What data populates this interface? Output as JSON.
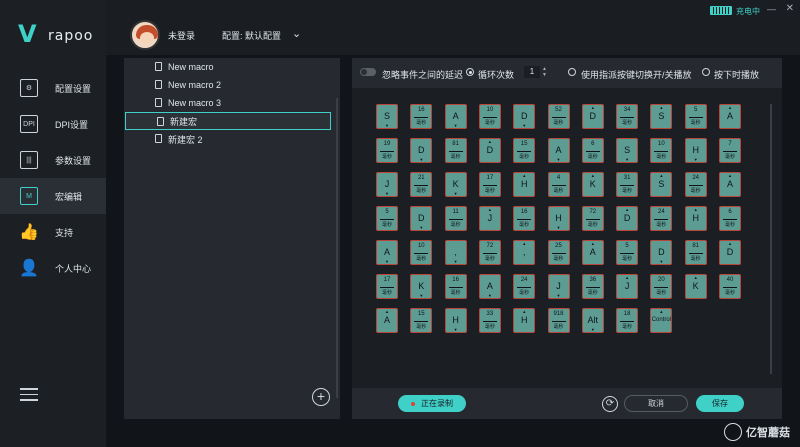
{
  "brand": {
    "logo_mark": "V",
    "logo_text": "rapoo"
  },
  "window": {
    "battery_icon": "battery-icon",
    "charging": "充电中",
    "min": "—",
    "close": "✕"
  },
  "header": {
    "login": "未登录",
    "config": "配置: 默认配置",
    "chevron": "⌄"
  },
  "sidebar": {
    "items": [
      {
        "label": "配置设置",
        "icon": "⚙",
        "active": false
      },
      {
        "label": "DPI设置",
        "icon": "DPI",
        "active": false
      },
      {
        "label": "参数设置",
        "icon": "|||",
        "active": false
      },
      {
        "label": "宏编辑",
        "icon": "M",
        "active": true
      },
      {
        "label": "支持",
        "icon": "👍",
        "active": false
      },
      {
        "label": "个人中心",
        "icon": "👤",
        "active": false
      }
    ]
  },
  "macros": {
    "items": [
      "New macro",
      "New macro 2",
      "New macro 3",
      "新建宏",
      "新建宏 2"
    ],
    "selected_index": 3,
    "add_label": "+"
  },
  "toolbar": {
    "ignore_delay": "忽略事件之间的延迟",
    "loop_count_label": "循环次数",
    "loop_count": "1",
    "toggle_mode": "使用指派按键切换开/关播放",
    "hold_mode": "按下时播放"
  },
  "delay_unit": "毫秒",
  "events": [
    [
      {
        "t": "k",
        "v": "S",
        "d": "down"
      },
      {
        "t": "d",
        "v": "16"
      },
      {
        "t": "k",
        "v": "A",
        "d": "down"
      },
      {
        "t": "d",
        "v": "10"
      },
      {
        "t": "k",
        "v": "D",
        "d": "down"
      },
      {
        "t": "d",
        "v": "52"
      },
      {
        "t": "k",
        "v": "D",
        "d": "up"
      },
      {
        "t": "d",
        "v": "34"
      },
      {
        "t": "k",
        "v": "S",
        "d": "up"
      },
      {
        "t": "d",
        "v": "5"
      },
      {
        "t": "k",
        "v": "A",
        "d": "up"
      }
    ],
    [
      {
        "t": "d",
        "v": "19"
      },
      {
        "t": "k",
        "v": "D",
        "d": "down"
      },
      {
        "t": "d",
        "v": "81"
      },
      {
        "t": "k",
        "v": "D",
        "d": "up"
      },
      {
        "t": "d",
        "v": "15"
      },
      {
        "t": "k",
        "v": "A",
        "d": "down"
      },
      {
        "t": "d",
        "v": "6"
      },
      {
        "t": "k",
        "v": "S",
        "d": "down"
      },
      {
        "t": "d",
        "v": "10"
      },
      {
        "t": "k",
        "v": "H",
        "d": "down"
      },
      {
        "t": "d",
        "v": "7"
      }
    ],
    [
      {
        "t": "k",
        "v": "J",
        "d": "down"
      },
      {
        "t": "d",
        "v": "21"
      },
      {
        "t": "k",
        "v": "K",
        "d": "down"
      },
      {
        "t": "d",
        "v": "17"
      },
      {
        "t": "k",
        "v": "H",
        "d": "up"
      },
      {
        "t": "d",
        "v": "4"
      },
      {
        "t": "k",
        "v": "K",
        "d": "up"
      },
      {
        "t": "d",
        "v": "31"
      },
      {
        "t": "k",
        "v": "S",
        "d": "up"
      },
      {
        "t": "d",
        "v": "24"
      },
      {
        "t": "k",
        "v": "A",
        "d": "up"
      }
    ],
    [
      {
        "t": "d",
        "v": "5"
      },
      {
        "t": "k",
        "v": "D",
        "d": "down"
      },
      {
        "t": "d",
        "v": "11"
      },
      {
        "t": "k",
        "v": "J",
        "d": "up"
      },
      {
        "t": "d",
        "v": "16"
      },
      {
        "t": "k",
        "v": "H",
        "d": "down"
      },
      {
        "t": "d",
        "v": "72"
      },
      {
        "t": "k",
        "v": "D",
        "d": "up"
      },
      {
        "t": "d",
        "v": "24"
      },
      {
        "t": "k",
        "v": "H",
        "d": "up"
      },
      {
        "t": "d",
        "v": "6"
      }
    ],
    [
      {
        "t": "k",
        "v": "A",
        "d": "down"
      },
      {
        "t": "d",
        "v": "10"
      },
      {
        "t": "k",
        "v": ",",
        "d": "down"
      },
      {
        "t": "d",
        "v": "72"
      },
      {
        "t": "k",
        "v": ",",
        "d": "up"
      },
      {
        "t": "d",
        "v": "25"
      },
      {
        "t": "k",
        "v": "A",
        "d": "up"
      },
      {
        "t": "d",
        "v": "5"
      },
      {
        "t": "k",
        "v": "D",
        "d": "down"
      },
      {
        "t": "d",
        "v": "81"
      },
      {
        "t": "k",
        "v": "D",
        "d": "up"
      }
    ],
    [
      {
        "t": "d",
        "v": "17"
      },
      {
        "t": "k",
        "v": "K",
        "d": "down"
      },
      {
        "t": "d",
        "v": "16"
      },
      {
        "t": "k",
        "v": "A",
        "d": "down"
      },
      {
        "t": "d",
        "v": "24"
      },
      {
        "t": "k",
        "v": "J",
        "d": "down"
      },
      {
        "t": "d",
        "v": "36"
      },
      {
        "t": "k",
        "v": "J",
        "d": "up"
      },
      {
        "t": "d",
        "v": "20"
      },
      {
        "t": "k",
        "v": "K",
        "d": "up"
      },
      {
        "t": "d",
        "v": "40"
      }
    ],
    [
      {
        "t": "k",
        "v": "A",
        "d": "up"
      },
      {
        "t": "d",
        "v": "15"
      },
      {
        "t": "k",
        "v": "H",
        "d": "down"
      },
      {
        "t": "d",
        "v": "33"
      },
      {
        "t": "k",
        "v": "H",
        "d": "up"
      },
      {
        "t": "d",
        "v": "918"
      },
      {
        "t": "k",
        "v": "Alt",
        "d": "down"
      },
      {
        "t": "d",
        "v": "18"
      },
      {
        "t": "k",
        "v": "Control",
        "d": "up"
      }
    ]
  ],
  "bottom": {
    "record": "正在录制",
    "reset": "⟳",
    "cancel": "取消",
    "save": "保存"
  },
  "watermark": {
    "text": "亿智蘑菇"
  },
  "colors": {
    "accent": "#3fd0c8",
    "cell_bg": "#5c9c93",
    "cell_border": "#b7473b"
  }
}
